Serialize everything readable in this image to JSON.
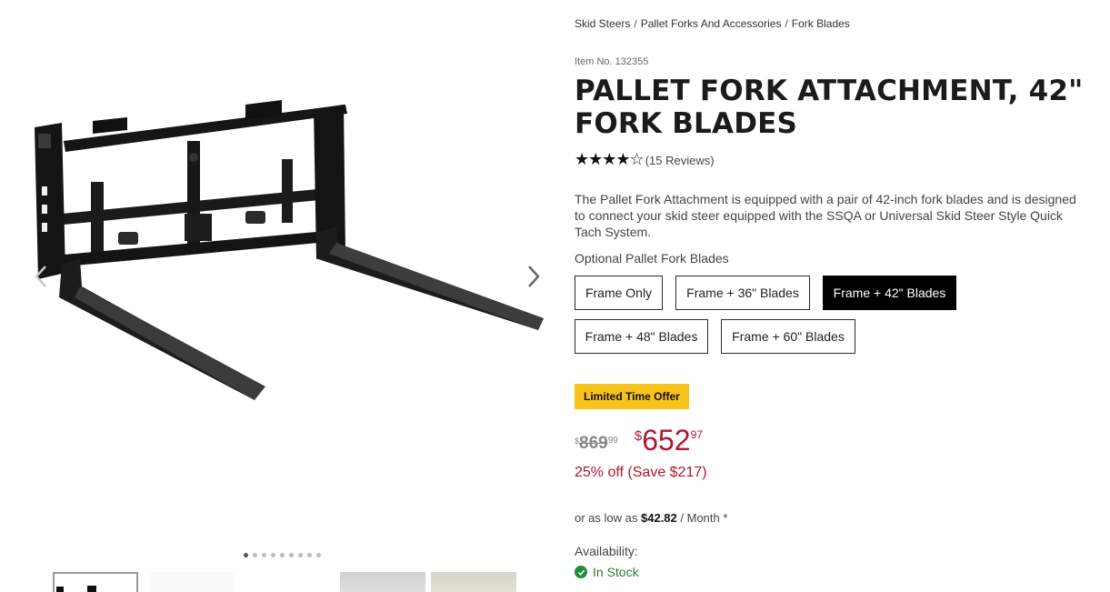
{
  "breadcrumb": [
    {
      "label": "Skid Steers"
    },
    {
      "label": "Pallet Forks And Accessories"
    },
    {
      "label": "Fork Blades"
    }
  ],
  "breadcrumb_separator": "/",
  "product": {
    "item_no": "Item No. 132355",
    "title": "PALLET FORK ATTACHMENT, 42\" FORK BLADES",
    "rating": 4.5,
    "stars_text": "★★★★☆",
    "reviews": "(15 Reviews)",
    "description": "The Pallet Fork Attachment is equipped with a pair of 42-inch fork blades and is designed to connect your skid steer equipped with the SSQA or Universal Skid Steer Style Quick Tach System."
  },
  "options": {
    "label": "Optional Pallet Fork Blades",
    "items": [
      {
        "label": "Frame Only",
        "selected": false
      },
      {
        "label": "Frame + 36\" Blades",
        "selected": false
      },
      {
        "label": "Frame + 42\" Blades",
        "selected": true
      },
      {
        "label": "Frame + 48\" Blades",
        "selected": false
      },
      {
        "label": "Frame + 60\" Blades",
        "selected": false
      }
    ]
  },
  "offer_badge": "Limited Time Offer",
  "price": {
    "currency": "$",
    "old_main": "869",
    "old_cents": "99",
    "new_main": "652",
    "new_cents": "97",
    "savings": "25% off (Save $217)"
  },
  "finance": {
    "prefix": "or as low as",
    "amount": "$42.82",
    "suffix": "/ Month *"
  },
  "availability": {
    "label": "Availability:",
    "status": "In Stock"
  },
  "gallery": {
    "dot_count": 9,
    "active_dot": 0,
    "icons": {
      "prev": "chevron-left-icon",
      "next": "chevron-right-icon"
    }
  },
  "colors": {
    "accent_red": "#b1162e",
    "badge_yellow": "#f7c21a",
    "stock_green": "#1e8e3e",
    "selected_option": "#000000"
  }
}
